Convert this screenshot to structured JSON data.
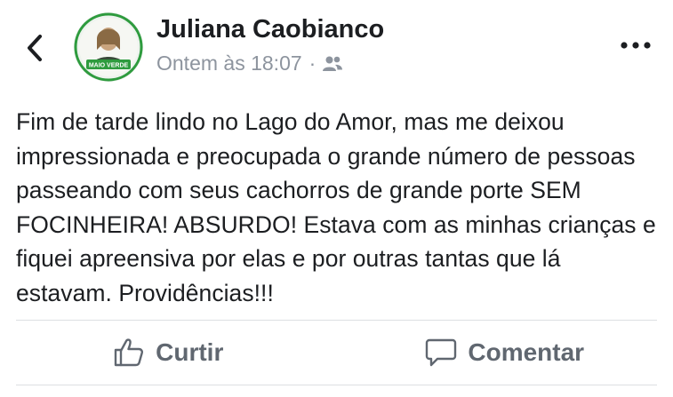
{
  "post": {
    "author": "Juliana Caobianco",
    "timestamp": "Ontem às 18:07",
    "separator": "·",
    "audience_icon": "friends-icon",
    "avatar_badge": "MAIO VERDE",
    "body": "Fim de tarde lindo no Lago do Amor, mas me deixou impressionada e preocupada o grande número de pessoas passeando com seus cachorros de grande porte SEM FOCINHEIRA! ABSURDO! Estava com as minhas crianças e fiquei apreensiva por elas e por outras tantas que lá estavam. Providências!!!"
  },
  "actions": {
    "like_label": "Curtir",
    "comment_label": "Comentar"
  },
  "colors": {
    "text": "#1c1e21",
    "secondary": "#8d949e",
    "action": "#606770",
    "divider": "#dddfe2",
    "avatar_ring": "#2e9b3e"
  }
}
